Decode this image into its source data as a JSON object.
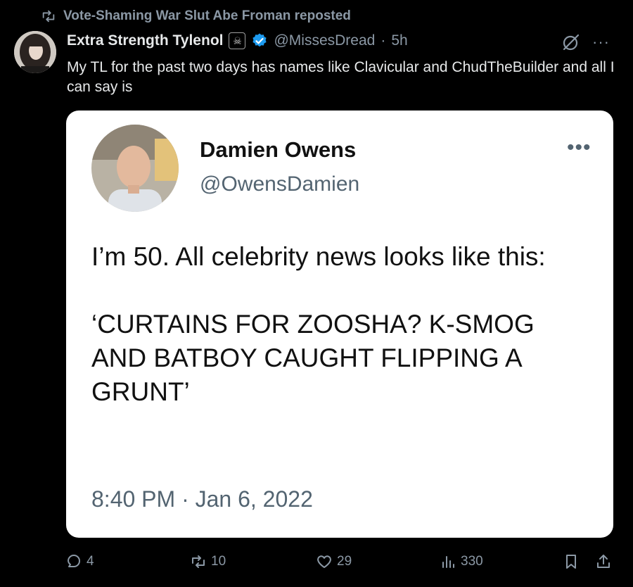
{
  "repost": {
    "text": "Vote-Shaming War Slut Abe Froman reposted",
    "icon": "repost-icon"
  },
  "author": {
    "display_name": "Extra Strength Tylenol",
    "badge_emoji": "☠",
    "handle": "@MissesDread",
    "separator": "·",
    "time": "5h"
  },
  "post_text": "My TL for the past two days has names like Clavicular and ChudTheBuilder and all I can say is",
  "quoted": {
    "name": "Damien Owens",
    "handle": "@OwensDamien",
    "body": "I’m 50. All celebrity news looks like this:\n\n‘CURTAINS FOR ZOOSHA? K-SMOG AND BATBOY CAUGHT FLIPPING A GRUNT’",
    "timestamp": "8:40 PM · Jan 6, 2022",
    "more": "•••"
  },
  "top_more": "···",
  "actions": {
    "replies": "4",
    "reposts": "10",
    "likes": "29",
    "views": "330"
  },
  "colors": {
    "background": "#000000",
    "muted": "#8b98a5",
    "verified": "#1d9bf0",
    "card": "#ffffff"
  }
}
